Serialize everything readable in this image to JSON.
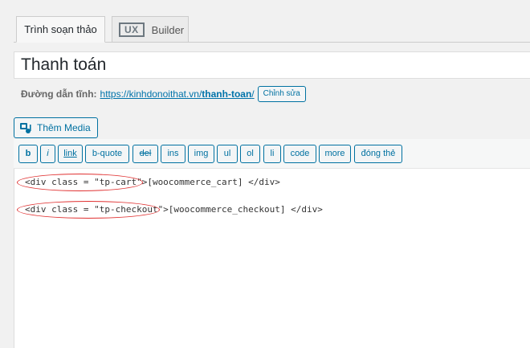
{
  "tabs": {
    "editor_label": "Trình soạn thảo",
    "ux_badge": "UX",
    "ux_label": "Builder"
  },
  "title": {
    "value": "Thanh toán"
  },
  "permalink": {
    "label": "Đường dẫn tĩnh:",
    "url_base": "https://kinhdonoithat.vn/",
    "url_slug": "thanh-toan",
    "url_trailing": "/",
    "edit_label": "Chỉnh sửa"
  },
  "media": {
    "label": "Thêm Media"
  },
  "quicktags": {
    "b": "b",
    "i": "i",
    "link": "link",
    "bquote": "b-quote",
    "del": "del",
    "ins": "ins",
    "img": "img",
    "ul": "ul",
    "ol": "ol",
    "li": "li",
    "code": "code",
    "more": "more",
    "close": "đóng thẻ"
  },
  "content": {
    "line1": "<div class = \"tp-cart\">[woocommerce_cart] </div>",
    "line2": "<div class = \"tp-checkout\">[woocommerce_checkout] </div>"
  },
  "colors": {
    "accent": "#0071a1",
    "annotation": "#e03131"
  }
}
